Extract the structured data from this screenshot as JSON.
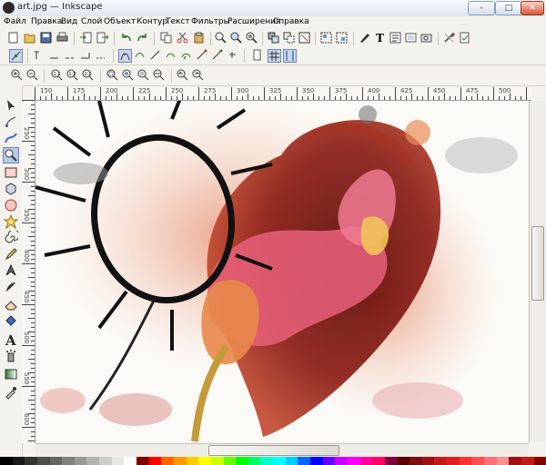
{
  "window": {
    "title": "art.jpg — Inkscape",
    "controls": {
      "minimize": "‐",
      "restore": "□",
      "close": "✕"
    }
  },
  "menu": [
    "Файл",
    "Правка",
    "Вид",
    "Слой",
    "Объект",
    "Контур",
    "Текст",
    "Фильтры",
    "Расширения",
    "Справка"
  ],
  "ruler": {
    "top_labels": [
      "150",
      "175",
      "200",
      "225",
      "250",
      "275",
      "300",
      "325",
      "350",
      "375",
      "400",
      "425",
      "450",
      "475",
      "500"
    ],
    "left_labels": [
      "250",
      "300",
      "350",
      "400",
      "450",
      "500",
      "550",
      "600"
    ]
  },
  "palette": [
    "#000000",
    "#1a1a1a",
    "#333333",
    "#4d4d4d",
    "#666666",
    "#808080",
    "#999999",
    "#b3b3b3",
    "#cccccc",
    "#e6e6e6",
    "#ffffff",
    "#800000",
    "#ff0000",
    "#ff6600",
    "#ff9900",
    "#ffcc00",
    "#ffff00",
    "#ccff00",
    "#66ff00",
    "#00ff00",
    "#00ff66",
    "#00ffcc",
    "#00ffff",
    "#00ccff",
    "#0066ff",
    "#0000ff",
    "#6600ff",
    "#cc00ff",
    "#ff00ff",
    "#ff0099",
    "#ff0066",
    "#800040",
    "#5a0000",
    "#7a1010",
    "#a01010",
    "#c01a1a",
    "#e02020",
    "#ff3030",
    "#ff5050",
    "#ff7070",
    "#ff9090",
    "#a01010",
    "#c01a1a",
    "#800000"
  ]
}
